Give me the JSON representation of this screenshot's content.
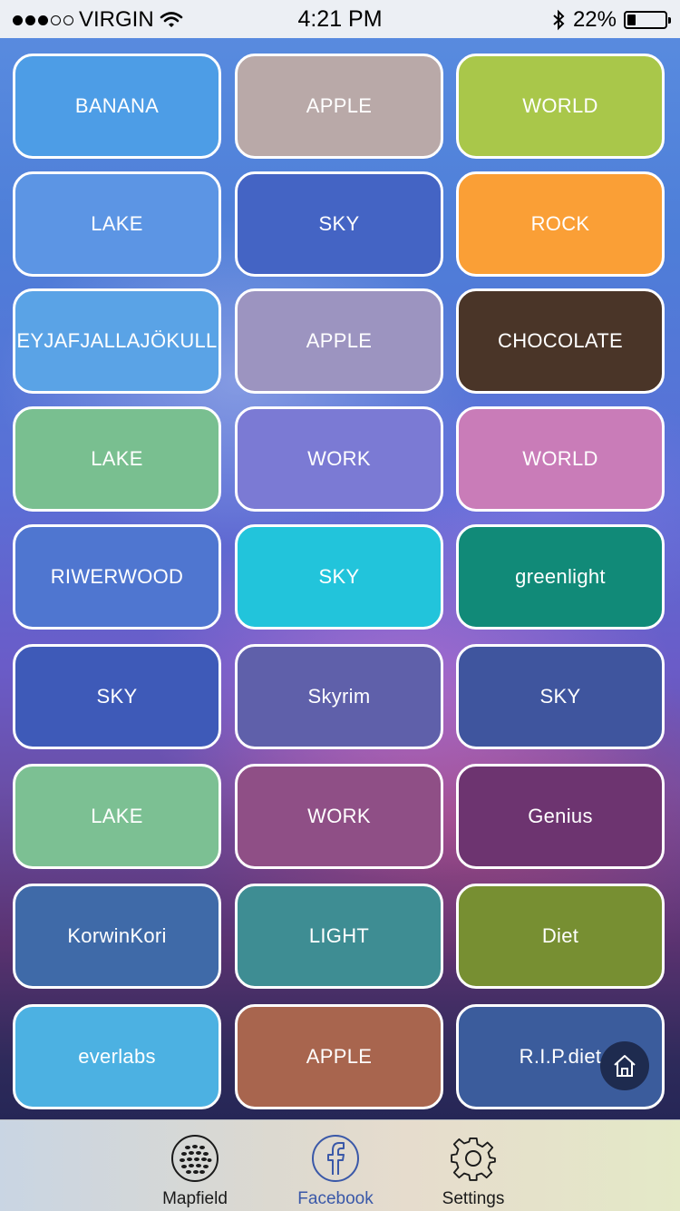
{
  "status_bar": {
    "carrier": "VIRGIN",
    "time": "4:21 PM",
    "battery": "22%"
  },
  "tiles": [
    {
      "label": "BANANA",
      "color": "#4d9de6"
    },
    {
      "label": "APPLE",
      "color": "#b9a9a8"
    },
    {
      "label": "WORLD",
      "color": "#a9c74a"
    },
    {
      "label": "LAKE",
      "color": "#5c95e4"
    },
    {
      "label": "SKY",
      "color": "#4464c4"
    },
    {
      "label": "ROCK",
      "color": "#fa9f36"
    },
    {
      "label": "EYJAFJALLAJÖKULL",
      "color": "#5aa3e6"
    },
    {
      "label": "APPLE",
      "color": "#9c94c0"
    },
    {
      "label": "CHOCOLATE",
      "color": "#4a3528"
    },
    {
      "label": "LAKE",
      "color": "#79bf90"
    },
    {
      "label": "WORK",
      "color": "#7b7ad4"
    },
    {
      "label": "WORLD",
      "color": "#c97cb8"
    },
    {
      "label": "RIWERWOOD",
      "color": "#4f76d0"
    },
    {
      "label": "SKY",
      "color": "#22c4db"
    },
    {
      "label": "greenlight",
      "color": "#118a78"
    },
    {
      "label": "SKY",
      "color": "#3e5ab8"
    },
    {
      "label": "Skyrim",
      "color": "#5f60aa"
    },
    {
      "label": "SKY",
      "color": "#3f559e"
    },
    {
      "label": "LAKE",
      "color": "#7cc093"
    },
    {
      "label": "WORK",
      "color": "#8f4f86"
    },
    {
      "label": "Genius",
      "color": "#6d3470"
    },
    {
      "label": "KorwinKori",
      "color": "#3f6aa8"
    },
    {
      "label": "LIGHT",
      "color": "#3e8d93"
    },
    {
      "label": "Diet",
      "color": "#778f32"
    },
    {
      "label": "everlabs",
      "color": "#4cb1e2"
    },
    {
      "label": "APPLE",
      "color": "#a8654e"
    },
    {
      "label": "R.I.P.diet",
      "color": "#3b5c9c"
    }
  ],
  "tab_bar": {
    "items": [
      {
        "label": "Mapfield",
        "icon": "golf-ball-icon"
      },
      {
        "label": "Facebook",
        "icon": "facebook-icon",
        "active": true
      },
      {
        "label": "Settings",
        "icon": "gear-icon"
      }
    ]
  },
  "colors": {
    "tab_active": "#3a58a8",
    "home_button": "#1e2b4f"
  }
}
